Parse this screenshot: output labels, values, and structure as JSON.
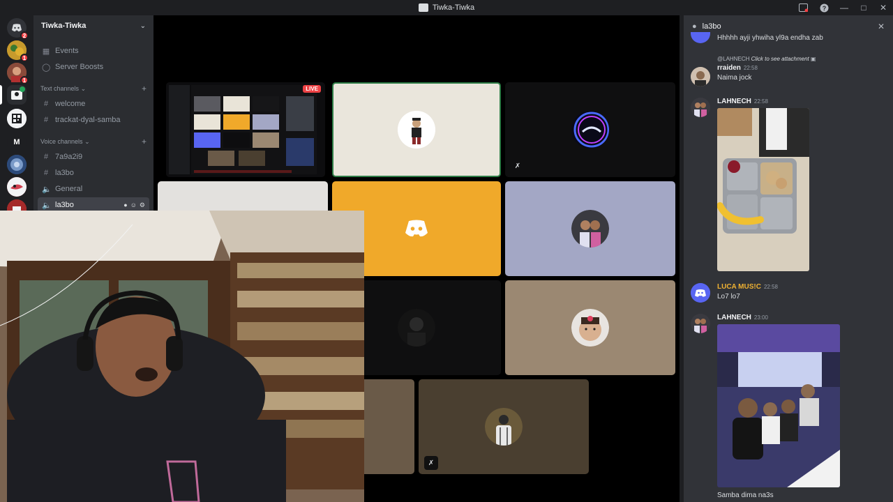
{
  "window": {
    "title": "Tiwka-Tiwka"
  },
  "servers": [
    {
      "name": "home",
      "badge": "2",
      "color": "#313338"
    },
    {
      "name": "server-2",
      "badge": "1",
      "color": "#c79a2c"
    },
    {
      "name": "server-3",
      "badge": "1",
      "color": "#b5573a"
    },
    {
      "name": "server-4",
      "badge": "",
      "color": "#5865f2"
    },
    {
      "name": "server-5",
      "badge": "",
      "color": "#f2f3f5"
    },
    {
      "name": "server-m",
      "label": "M",
      "badge": "",
      "color": "#1e1f22"
    },
    {
      "name": "server-7",
      "badge": "",
      "color": "#4a6aa5"
    },
    {
      "name": "server-8",
      "badge": "",
      "color": "#d04050"
    },
    {
      "name": "server-9",
      "badge": "",
      "color": "#c0392b"
    }
  ],
  "guild": {
    "name": "Tiwka-Tiwka"
  },
  "sidebar": {
    "events": "Events",
    "boosts": "Server Boosts",
    "text_category": "Text channels",
    "text_channels": [
      "welcome",
      "trackat-dyal-samba"
    ],
    "voice_category": "Voice channels",
    "voice_channels": [
      "7a9a2i9",
      "la3bo",
      "General",
      "la3bo"
    ]
  },
  "stage": {
    "live_label": "LIVE"
  },
  "chat": {
    "channel": "la3bo",
    "messages": [
      {
        "text": "Hhhhh ayji yhwiha yl9a endha zab"
      },
      {
        "reply_author": "@LAHNECH",
        "reply_text": "Click to see attachment",
        "author": "rraiden",
        "time": "22:58",
        "text": "Naima jock"
      },
      {
        "author": "LAHNECH",
        "time": "22:58"
      },
      {
        "author": "LUCA MUS!C",
        "time": "22:58",
        "text": "Lo7 lo7",
        "author_color": "#f0b232"
      },
      {
        "author": "LAHNECH",
        "time": "23:00",
        "text": "Samba dima na3s"
      }
    ]
  }
}
